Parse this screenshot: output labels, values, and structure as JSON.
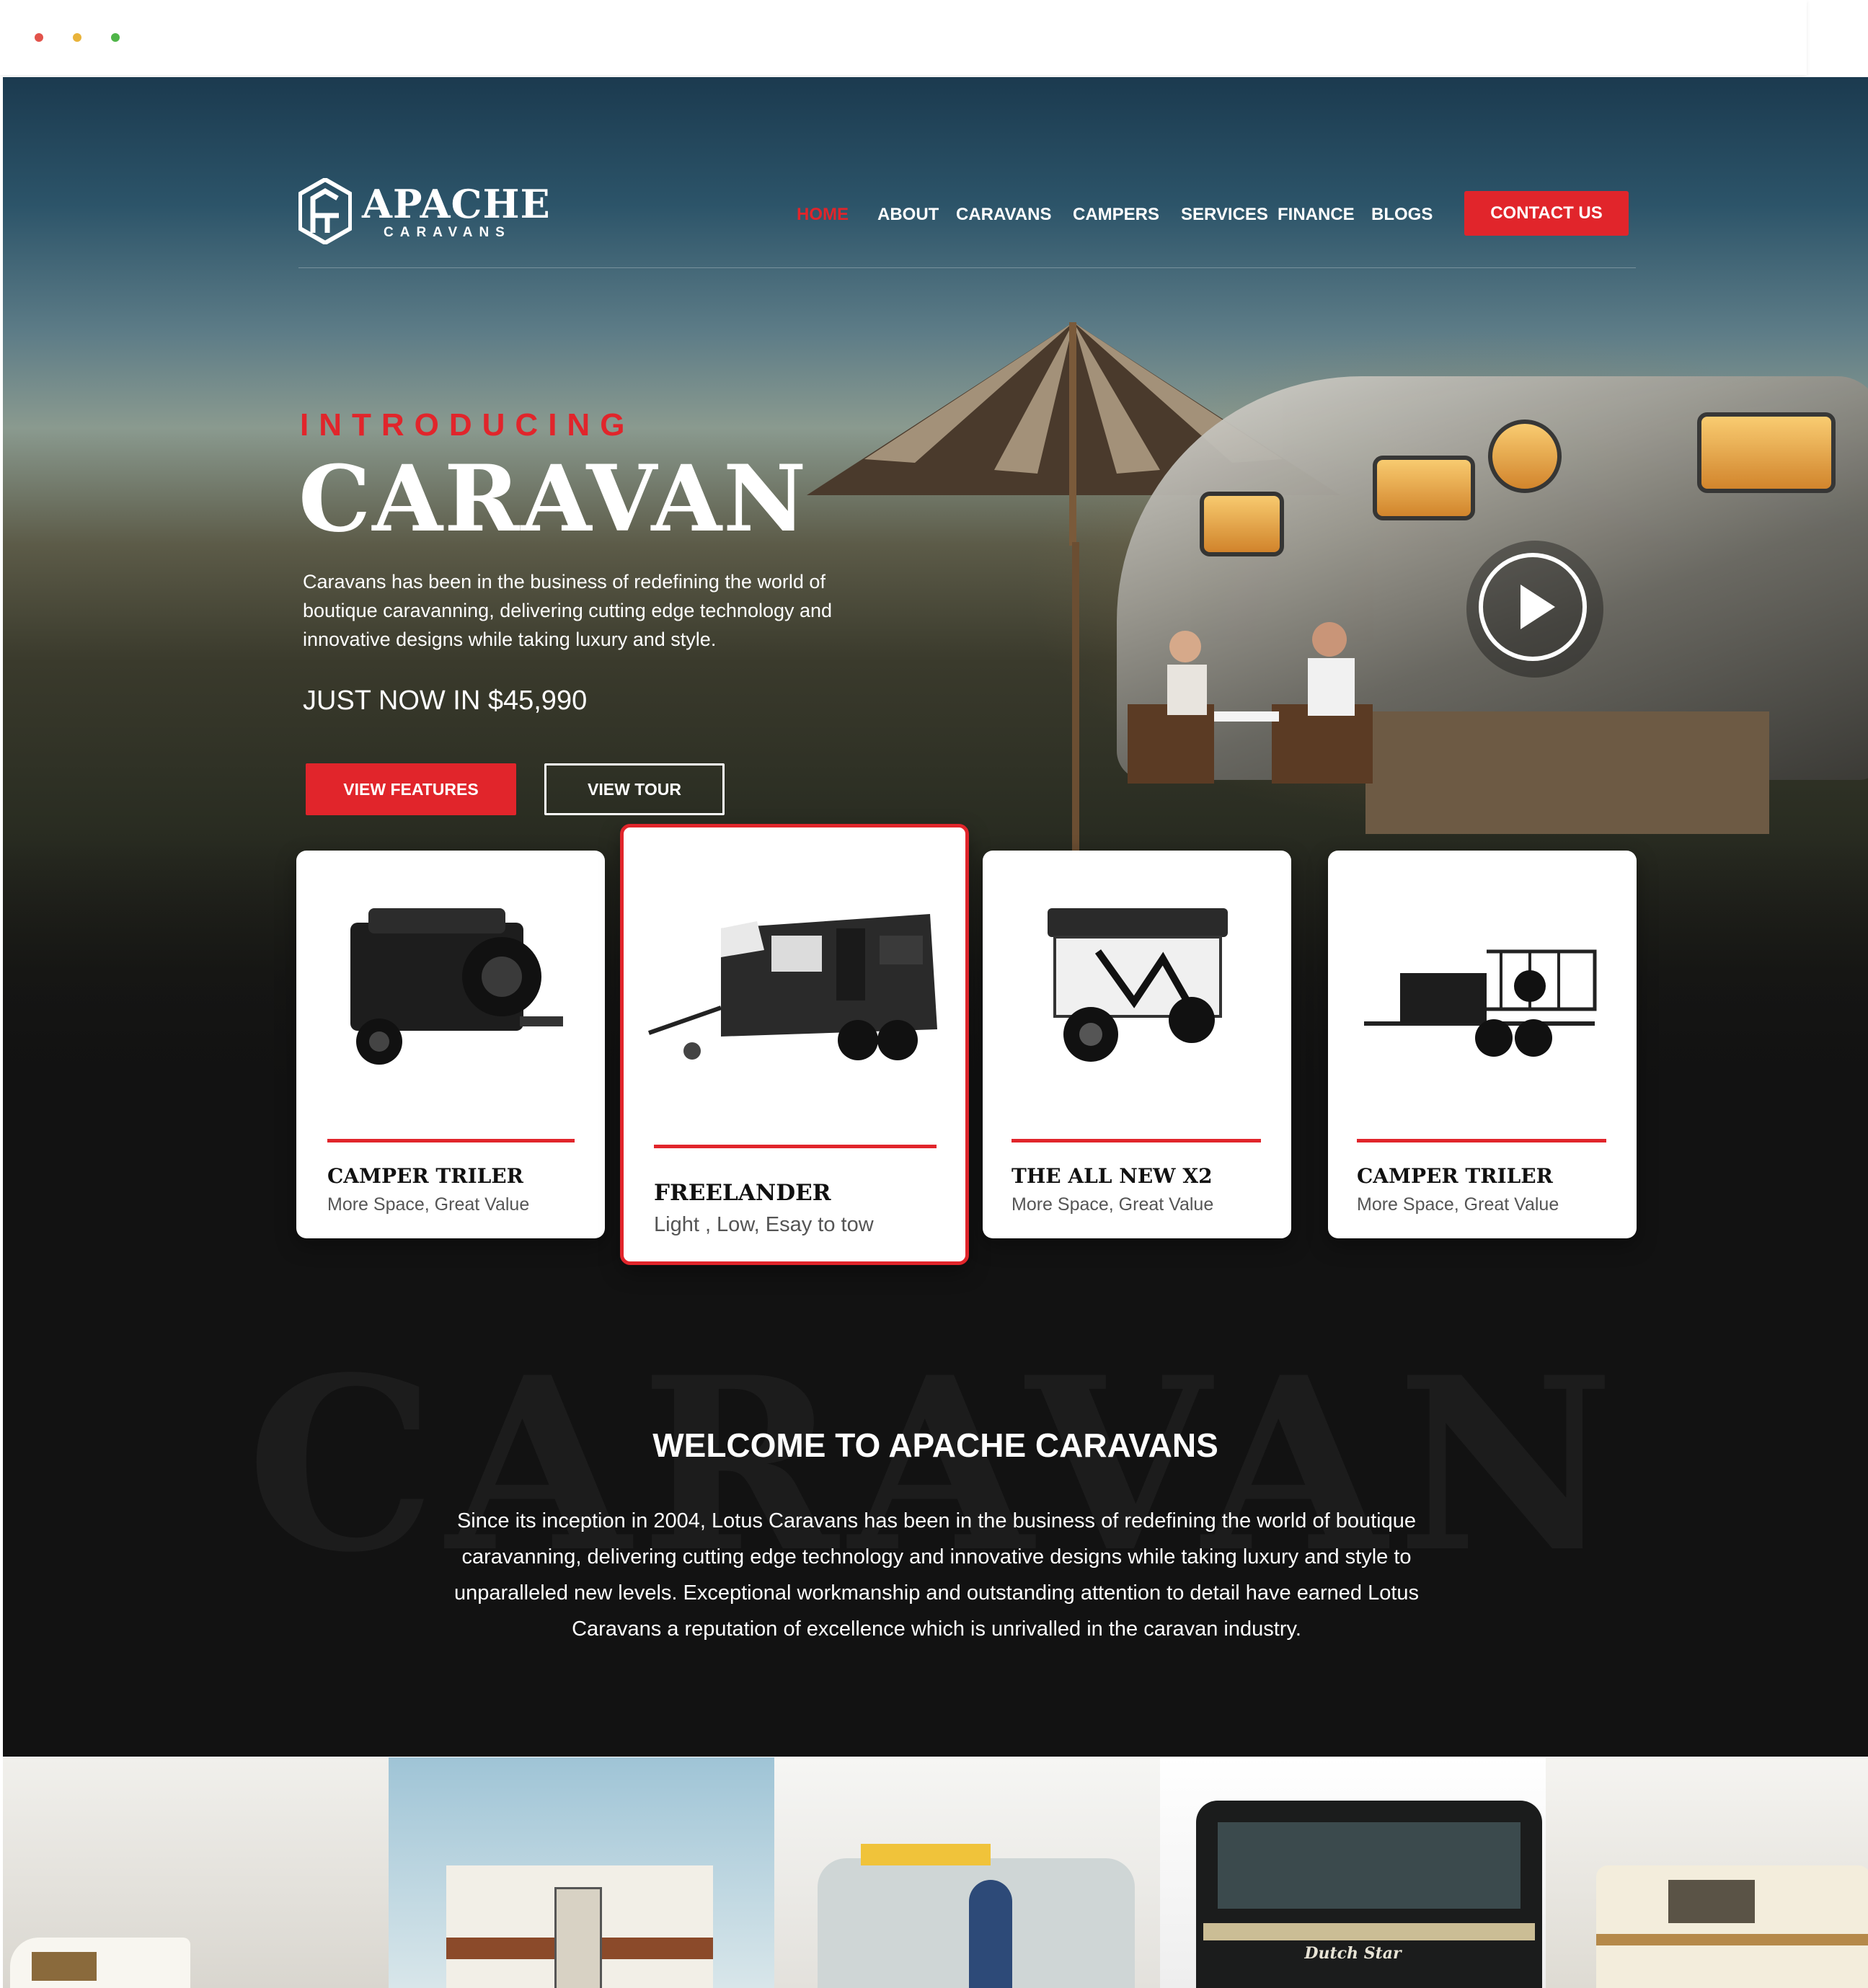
{
  "window": {
    "dots": [
      "#e2534b",
      "#e9b33a",
      "#4fb548"
    ]
  },
  "brand": {
    "name": "APACHE",
    "tagline": "CARAVANS"
  },
  "nav": {
    "items": [
      {
        "label": "HOME",
        "active": true
      },
      {
        "label": "ABOUT"
      },
      {
        "label": "CARAVANS"
      },
      {
        "label": "CAMPERS"
      },
      {
        "label": "SERVICES"
      },
      {
        "label": "FINANCE"
      },
      {
        "label": "BLOGS"
      }
    ],
    "contact": "CONTACT US"
  },
  "hero": {
    "eyebrow": "INTRODUCING",
    "headline": "CARAVAN",
    "description": "Caravans has been in the business of redefining the world of boutique caravanning, delivering cutting edge technology and innovative designs while taking luxury and style.",
    "price": "JUST NOW IN $45,990",
    "primary_button": "VIEW FEATURES",
    "secondary_button": "VIEW TOUR"
  },
  "products": [
    {
      "title": "CAMPER TRILER",
      "subtitle": "More Space, Great Value"
    },
    {
      "title": "FREELANDER",
      "subtitle": "Light , Low, Esay to tow"
    },
    {
      "title": "THE ALL NEW X2",
      "subtitle": "More Space, Great Value"
    },
    {
      "title": "CAMPER TRILER",
      "subtitle": "More Space, Great Value"
    }
  ],
  "welcome": {
    "watermark": "CARAVAN",
    "title": "WELCOME TO APACHE CARAVANS",
    "text": "Since its inception in 2004, Lotus Caravans has been in the business of redefining the world of boutique caravanning, delivering cutting edge technology and innovative designs while taking luxury and style to unparalleled new levels. Exceptional workmanship and outstanding attention to detail have earned Lotus Caravans a reputation of excellence which is unrivalled in the caravan industry."
  },
  "gallery": {
    "brand_text": "Dutch Star"
  },
  "colors": {
    "accent": "#e1252b",
    "dark": "#121212"
  }
}
